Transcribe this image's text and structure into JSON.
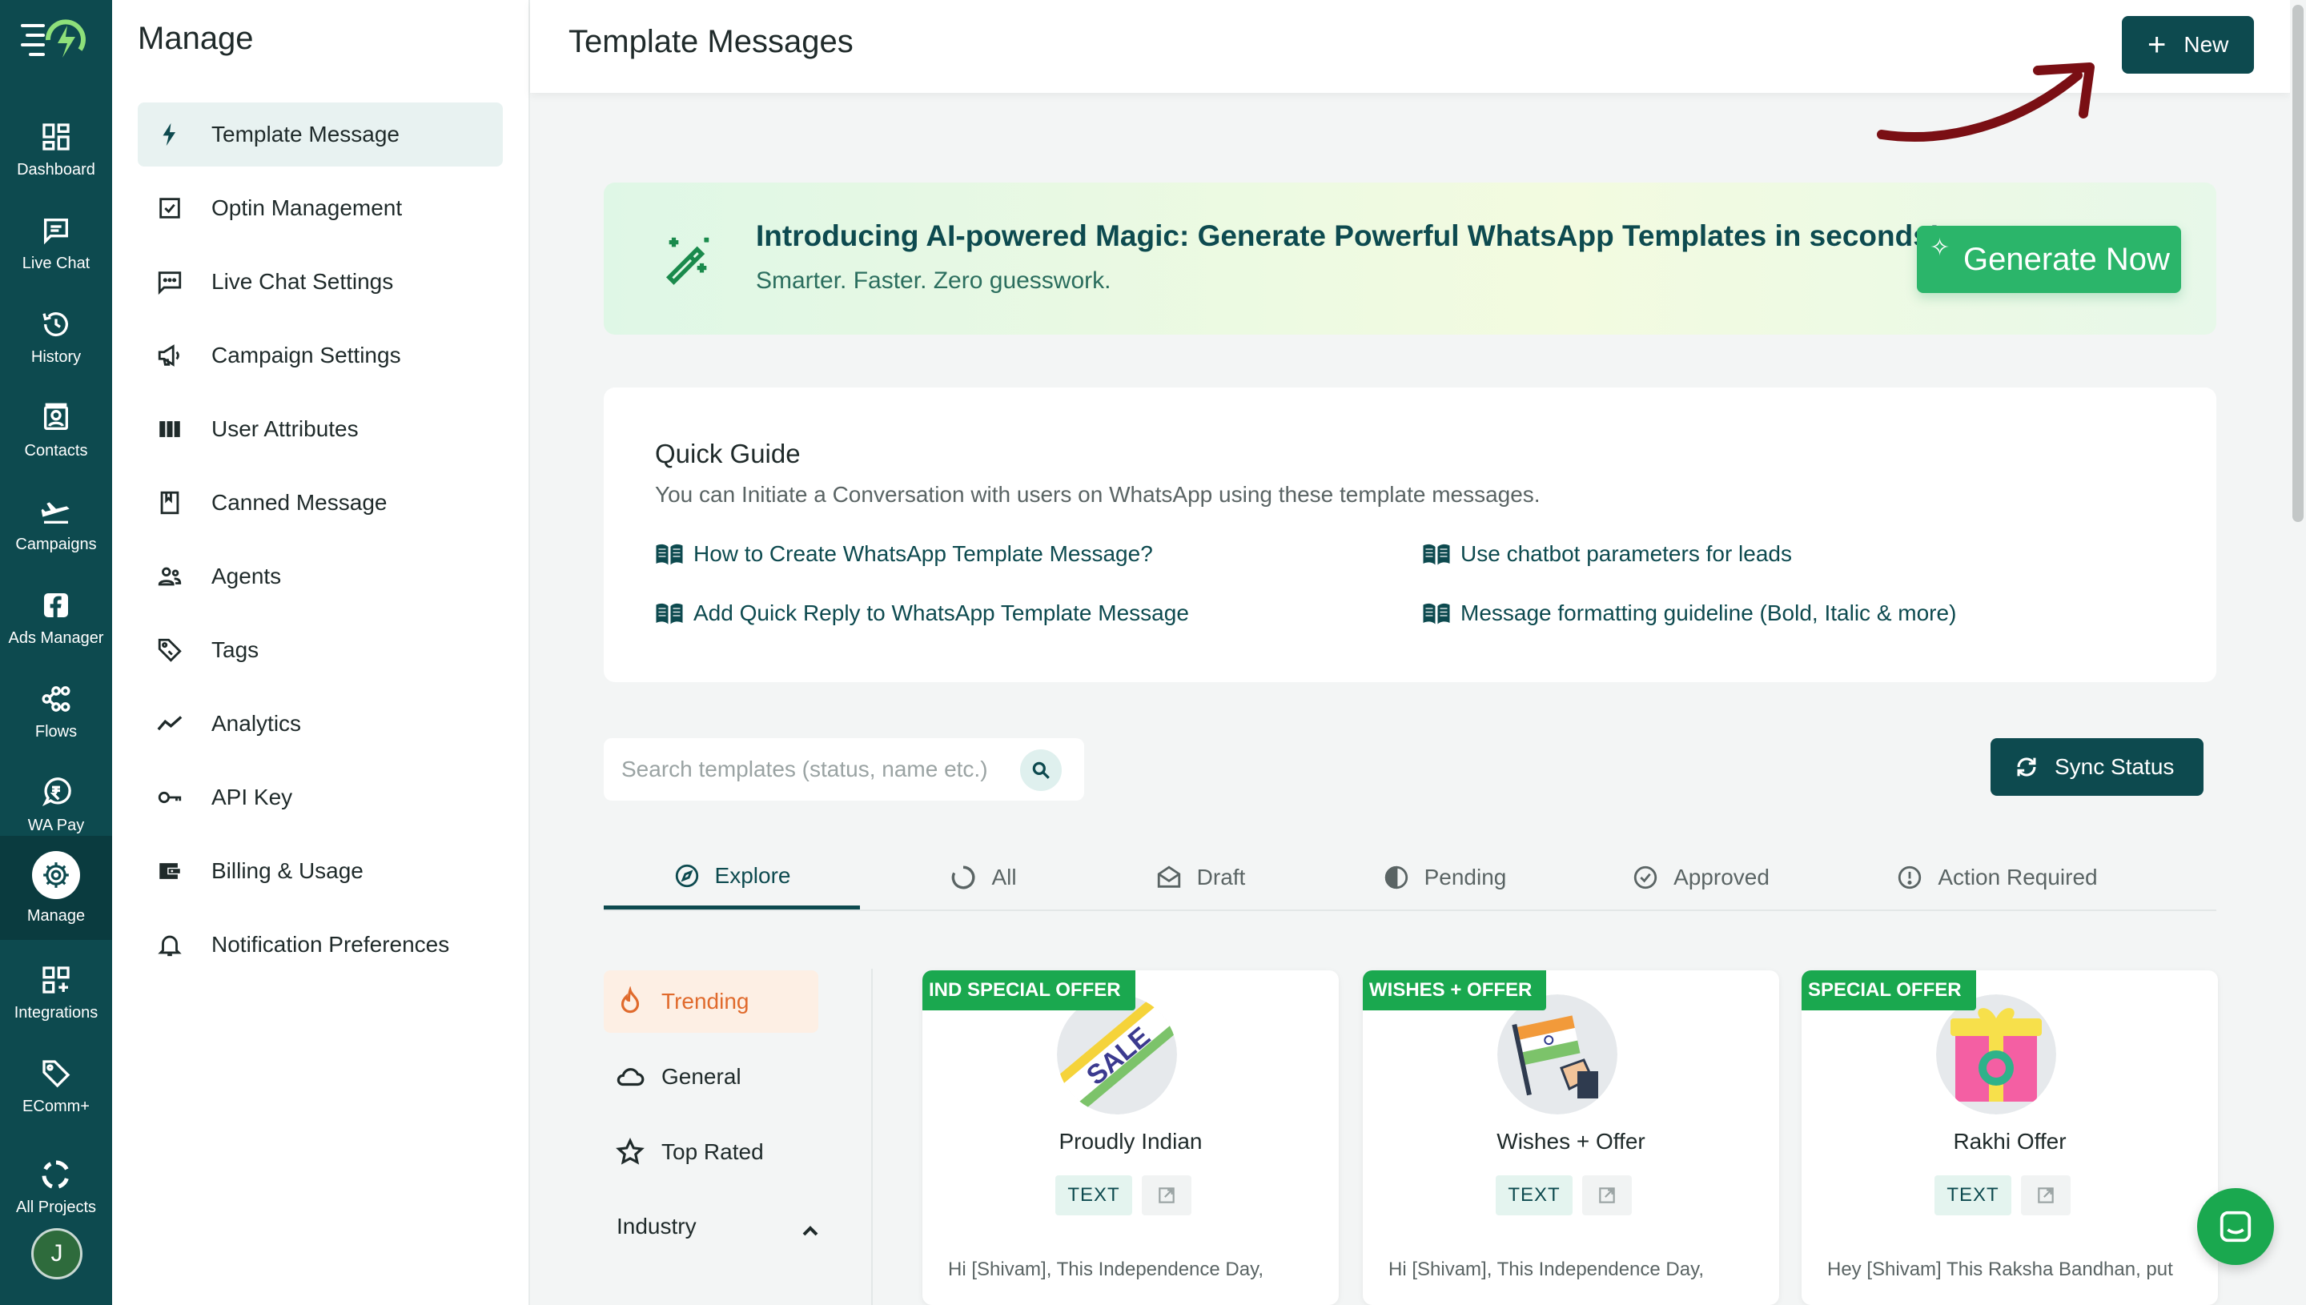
{
  "rail": {
    "items": [
      {
        "label": "Dashboard",
        "icon": "dashboard-icon"
      },
      {
        "label": "Live Chat",
        "icon": "chat-icon"
      },
      {
        "label": "History",
        "icon": "history-icon"
      },
      {
        "label": "Contacts",
        "icon": "contacts-icon"
      },
      {
        "label": "Campaigns",
        "icon": "plane-icon"
      },
      {
        "label": "Ads Manager",
        "icon": "facebook-icon"
      },
      {
        "label": "Flows",
        "icon": "flows-icon"
      },
      {
        "label": "WA Pay",
        "icon": "rupee-icon"
      },
      {
        "label": "Manage",
        "icon": "gear-icon"
      },
      {
        "label": "Integrations",
        "icon": "integrations-icon"
      },
      {
        "label": "EComm+",
        "icon": "tag-icon"
      },
      {
        "label": "All Projects",
        "icon": "projects-icon"
      }
    ],
    "avatar_initial": "J"
  },
  "sidebar": {
    "title": "Manage",
    "items": [
      {
        "label": "Template Message",
        "icon": "bolt-icon"
      },
      {
        "label": "Optin Management",
        "icon": "checkbox-icon"
      },
      {
        "label": "Live Chat Settings",
        "icon": "chat-dots-icon"
      },
      {
        "label": "Campaign Settings",
        "icon": "megaphone-icon"
      },
      {
        "label": "User Attributes",
        "icon": "columns-icon"
      },
      {
        "label": "Canned Message",
        "icon": "bookmark-icon"
      },
      {
        "label": "Agents",
        "icon": "agents-icon"
      },
      {
        "label": "Tags",
        "icon": "tags-icon"
      },
      {
        "label": "Analytics",
        "icon": "analytics-icon"
      },
      {
        "label": "API Key",
        "icon": "key-icon"
      },
      {
        "label": "Billing & Usage",
        "icon": "wallet-icon"
      },
      {
        "label": "Notification Preferences",
        "icon": "bell-icon"
      }
    ]
  },
  "header": {
    "title": "Template Messages",
    "new_label": "New"
  },
  "ai_banner": {
    "title": "Introducing AI-powered Magic: Generate Powerful WhatsApp Templates in seconds!",
    "subtitle": "Smarter. Faster. Zero guesswork.",
    "button_label": "Generate Now"
  },
  "guide": {
    "title": "Quick Guide",
    "description": "You can Initiate a Conversation with users on WhatsApp using these template messages.",
    "links": [
      "How to Create WhatsApp Template Message?",
      "Use chatbot parameters for leads",
      "Add Quick Reply to WhatsApp Template Message",
      "Message formatting guideline (Bold, Italic & more)"
    ]
  },
  "search": {
    "placeholder": "Search templates (status, name etc.)"
  },
  "sync_label": "Sync Status",
  "tabs": [
    {
      "label": "Explore",
      "icon": "compass-icon"
    },
    {
      "label": "All",
      "icon": "circle-icon"
    },
    {
      "label": "Draft",
      "icon": "envelope-icon"
    },
    {
      "label": "Pending",
      "icon": "pending-icon"
    },
    {
      "label": "Approved",
      "icon": "check-circle-icon"
    },
    {
      "label": "Action Required",
      "icon": "alert-icon"
    }
  ],
  "categories": [
    {
      "label": "Trending",
      "icon": "fire-icon"
    },
    {
      "label": "General",
      "icon": "cloud-icon"
    },
    {
      "label": "Top Rated",
      "icon": "star-icon"
    }
  ],
  "industry_label": "Industry",
  "cards": [
    {
      "badge": "IND SPECIAL OFFER",
      "title": "Proudly Indian",
      "type": "TEXT",
      "body": "Hi [Shivam], This Independence Day,",
      "image_text": "SALE"
    },
    {
      "badge": "WISHES + OFFER",
      "title": "Wishes + Offer",
      "type": "TEXT",
      "body": "Hi [Shivam], This Independence Day,"
    },
    {
      "badge": "SPECIAL OFFER",
      "title": "Rakhi Offer",
      "type": "TEXT",
      "body": "Hey [Shivam] This Raksha Bandhan, put"
    }
  ],
  "colors": {
    "primary": "#0d4a4f",
    "accent_green": "#1aa84f",
    "trending_orange": "#e06a2c",
    "arrow": "#7a0f14"
  }
}
